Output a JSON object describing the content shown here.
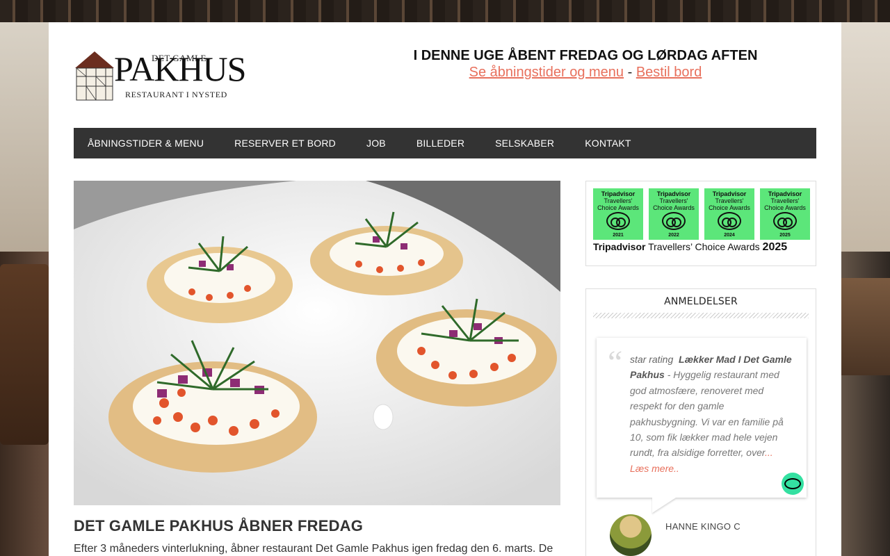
{
  "site": {
    "logo": {
      "det_gamle": "DET GAMLE",
      "pakhus": "PAKHUS",
      "subtitle": "RESTAURANT I NYSTED"
    },
    "announcement": {
      "headline": "I DENNE UGE ÅBENT FREDAG OG LØRDAG AFTEN",
      "link_menu": "Se åbningstider og menu",
      "separator": "-",
      "link_book": "Bestil bord"
    },
    "colors": {
      "accent": "#e8705c",
      "nav_bg": "#333333",
      "tripadvisor_green": "#34e0a1"
    }
  },
  "nav": {
    "items": [
      {
        "label": "ÅBNINGSTIDER & MENU"
      },
      {
        "label": "RESERVER ET BORD"
      },
      {
        "label": "JOB"
      },
      {
        "label": "BILLEDER"
      },
      {
        "label": "SELSKABER"
      },
      {
        "label": "KONTAKT"
      }
    ]
  },
  "post": {
    "title": "DET GAMLE PAKHUS ÅBNER FREDAG",
    "excerpt": "Efter 3 måneders vinterlukning, åbner restaurant Det Gamle Pakhus igen fredag den 6. marts. De"
  },
  "awards": {
    "badges": [
      {
        "line1": "Tripadvisor",
        "line2": "Travellers'",
        "line3": "Choice Awards",
        "year": "2021"
      },
      {
        "line1": "Tripadvisor",
        "line2": "Travellers'",
        "line3": "Choice Awards",
        "year": "2022"
      },
      {
        "line1": "Tripadvisor",
        "line2": "Travellers'",
        "line3": "Choice Awards",
        "year": "2024"
      },
      {
        "line1": "Tripadvisor",
        "line2": "Travellers'",
        "line3": "Choice Awards",
        "year": "2025"
      }
    ],
    "caption_brand": "Tripadvisor",
    "caption_text": "Travellers’ Choice Awards",
    "caption_year": "2025"
  },
  "reviews": {
    "widget_title": "ANMELDELSER",
    "rating_alt": "star rating",
    "review_title": "Lækker Mad I Det Gamle Pakhus",
    "review_body": " - Hyggelig restaurant med god atmosfære, renoveret med respekt for den gamle pakhusbygning. Vi var en familie på 10, som fik lækker mad hele vejen rundt, fra alsidige forretter, over",
    "read_more": "... Læs mere..",
    "reviewer_name": "HANNE KINGO C"
  }
}
